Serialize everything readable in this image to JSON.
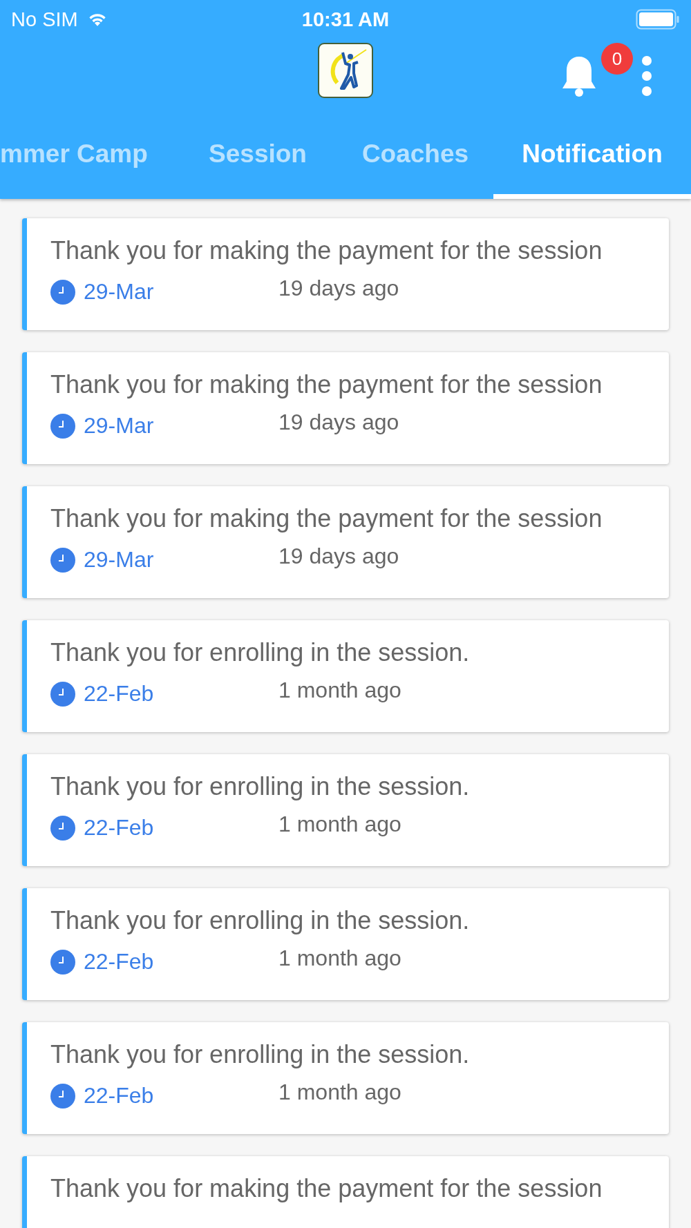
{
  "status_bar": {
    "carrier": "No SIM",
    "time": "10:31 AM"
  },
  "toolbar": {
    "notification_count": "0"
  },
  "tabs": [
    {
      "label": "mmer Camp",
      "selected": false
    },
    {
      "label": "Session",
      "selected": false
    },
    {
      "label": "Coaches",
      "selected": false
    },
    {
      "label": "Notification",
      "selected": true
    }
  ],
  "notifications": [
    {
      "message": "Thank you for making the payment for the session",
      "date": "29-Mar",
      "ago": "19 days ago"
    },
    {
      "message": "Thank you for making the payment for the session",
      "date": "29-Mar",
      "ago": "19 days ago"
    },
    {
      "message": "Thank you for making the payment for the session",
      "date": "29-Mar",
      "ago": "19 days ago"
    },
    {
      "message": "Thank you for enrolling in the session.",
      "date": "22-Feb",
      "ago": "1 month ago"
    },
    {
      "message": "Thank you for enrolling in the session.",
      "date": "22-Feb",
      "ago": "1 month ago"
    },
    {
      "message": "Thank you for enrolling in the session.",
      "date": "22-Feb",
      "ago": "1 month ago"
    },
    {
      "message": "Thank you for enrolling in the session.",
      "date": "22-Feb",
      "ago": "1 month ago"
    },
    {
      "message": "Thank you for making the payment for the session"
    }
  ]
}
